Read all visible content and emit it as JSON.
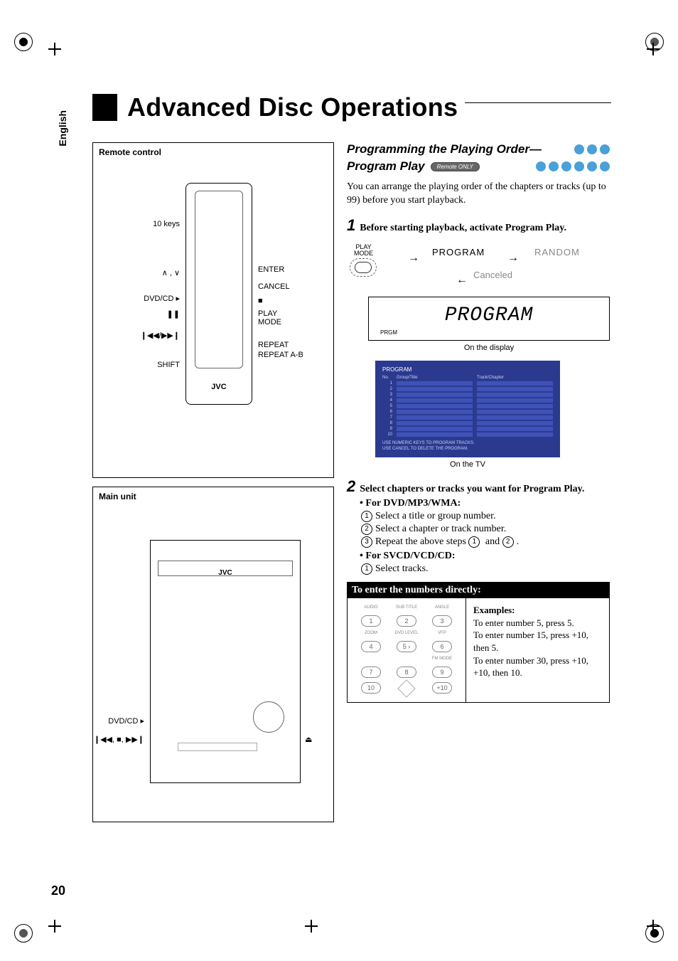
{
  "page_number": "20",
  "language_tab": "English",
  "title": "Advanced Disc Operations",
  "left": {
    "remote_label": "Remote control",
    "main_label": "Main unit",
    "brand": "JVC",
    "remote_callouts": {
      "ten_keys": "10 keys",
      "up_down_icon": "∧ , ∨",
      "dvd_cd": "DVD/CD ▸",
      "pause_icon": "❚❚",
      "skip_icon": "❙◀◀/▶▶❙",
      "shift": "SHIFT",
      "enter": "ENTER",
      "cancel": "CANCEL",
      "stop_icon": "■",
      "play_mode_1": "PLAY",
      "play_mode_2": "MODE",
      "repeat": "REPEAT",
      "repeat_ab": "REPEAT A-B"
    },
    "main_callouts": {
      "dvd_cd": "DVD/CD ▸",
      "transport_icon": "❙◀◀, ■, ▶▶❙",
      "eject_icon": "⏏"
    }
  },
  "right": {
    "section_title_1": "Programming the Playing Order—",
    "section_title_2": "Program Play",
    "remote_only_badge": "Remote ONLY",
    "intro": "You can arrange the playing order of the chapters or tracks (up to 99) before you start playback.",
    "step1": {
      "num": "1",
      "text": "Before starting playback, activate Program Play."
    },
    "mode_diagram": {
      "play_mode_label_1": "PLAY",
      "play_mode_label_2": "MODE",
      "program": "PROGRAM",
      "random": "RANDOM",
      "canceled": "Canceled"
    },
    "display": {
      "prgm": "PRGM",
      "segment": "PROGRAM",
      "caption": "On the display"
    },
    "tv": {
      "header": "PROGRAM",
      "col_no": "No.",
      "col_group": "Group/Title",
      "col_track": "Track/Chapter",
      "rows": [
        "1",
        "2",
        "3",
        "4",
        "5",
        "6",
        "7",
        "8",
        "9",
        "10"
      ],
      "note1": "USE NUMERIC KEYS TO PROGRAM TRACKS.",
      "note2": "USE CANCEL TO DELETE THE PROGRAM.",
      "caption": "On the TV"
    },
    "step2": {
      "num": "2",
      "text": "Select chapters or tracks you want for Program Play.",
      "dvd_heading": "• For DVD/MP3/WMA:",
      "dvd_1": "Select a title or group number.",
      "dvd_2": "Select a chapter or track number.",
      "dvd_3_a": "Repeat the above steps ",
      "dvd_3_b": " and ",
      "dvd_3_c": ".",
      "svcd_heading": "• For SVCD/VCD/CD:",
      "svcd_1": "Select tracks."
    },
    "enter_box": {
      "header": "To enter the numbers directly:",
      "keypad_labels": {
        "audio": "AUDIO",
        "subtitle": "SUB TITLE",
        "angle": "ANGLE",
        "zoom": "ZOOM",
        "dvdlevel": "DVD LEVEL",
        "vfp": "VFP",
        "fmmode": "FM MODE"
      },
      "keys": {
        "k1": "1",
        "k2": "2",
        "k3": "3",
        "k4": "4",
        "k5": "5 ›",
        "k6": "6",
        "k7": "7",
        "k8": "8",
        "k9": "9",
        "k10": "10",
        "kplus10": "+10"
      },
      "examples_heading": "Examples:",
      "ex1": "To enter number 5, press 5.",
      "ex2": "To enter number 15, press +10, then 5.",
      "ex3": "To enter number 30, press +10, +10, then 10."
    }
  }
}
